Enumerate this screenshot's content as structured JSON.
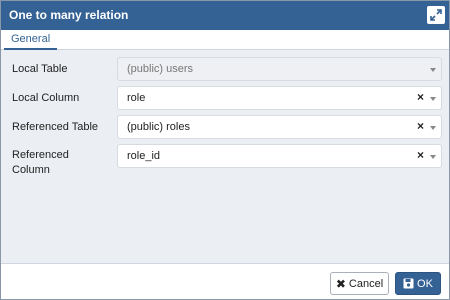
{
  "dialog": {
    "title": "One to many relation",
    "expand_icon": "expand-icon"
  },
  "tabs": [
    {
      "label": "General",
      "active": true
    }
  ],
  "form": {
    "local_table": {
      "label": "Local Table",
      "value": "(public) users",
      "disabled": true
    },
    "local_column": {
      "label": "Local Column",
      "value": "role",
      "clear_glyph": "×"
    },
    "referenced_table": {
      "label": "Referenced Table",
      "value": "(public) roles",
      "clear_glyph": "×"
    },
    "referenced_column": {
      "label_line1": "Referenced",
      "label_line2": "Column",
      "value": "role_id",
      "clear_glyph": "×"
    }
  },
  "footer": {
    "cancel_label": "Cancel",
    "cancel_glyph": "✖",
    "ok_label": "OK",
    "ok_icon": "save-icon"
  },
  "colors": {
    "titlebar": "#356294",
    "accent": "#356294",
    "body": "#ebeef3"
  }
}
